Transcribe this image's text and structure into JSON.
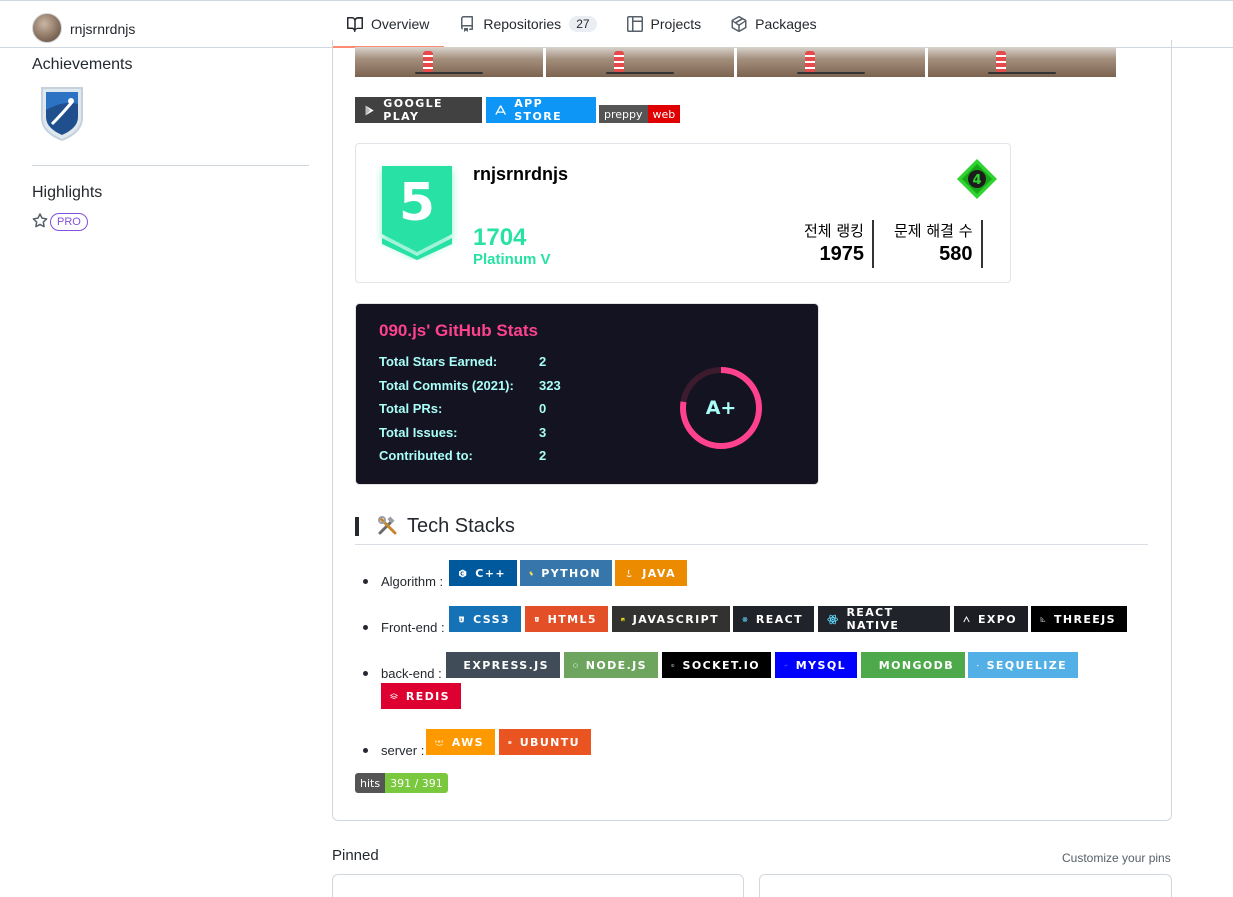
{
  "header": {
    "username": "rnjsrnrdnjs",
    "tabs": [
      {
        "label": "Overview",
        "icon": "book-icon",
        "active": true
      },
      {
        "label": "Repositories",
        "icon": "repo-icon",
        "count": "27"
      },
      {
        "label": "Projects",
        "icon": "project-icon"
      },
      {
        "label": "Packages",
        "icon": "package-icon"
      }
    ]
  },
  "sidebar": {
    "achievements_title": "Achievements",
    "highlights_title": "Highlights",
    "pro_label": "PRO"
  },
  "readme": {
    "store_badges": [
      {
        "label": "GOOGLE PLAY",
        "color": "#414141",
        "icon": "google-play-icon"
      },
      {
        "label": "APP STORE",
        "color": "#0d96f6",
        "icon": "app-store-icon"
      }
    ],
    "preppy_badge": {
      "left": "preppy",
      "right": "web",
      "right_color": "#e10000"
    },
    "solved": {
      "username": "rnjsrnrdnjs",
      "tier_number": "5",
      "rating": "1704",
      "tier_name": "Platinum V",
      "class_number": "4",
      "rank_label": "전체 랭킹",
      "rank_value": "1975",
      "solved_label": "문제 해결 수",
      "solved_value": "580",
      "accent": "#27e2a4"
    },
    "github_stats": {
      "title": "090.js' GitHub Stats",
      "rows": [
        {
          "label": "Total Stars Earned:",
          "value": "2"
        },
        {
          "label": "Total Commits (2021):",
          "value": "323"
        },
        {
          "label": "Total PRs:",
          "value": "0"
        },
        {
          "label": "Total Issues:",
          "value": "3"
        },
        {
          "label": "Contributed to:",
          "value": "2"
        }
      ],
      "grade": "A+",
      "bg": "#141321",
      "title_color": "#fe428e",
      "text_color": "#a9fef7"
    },
    "tech_stacks": {
      "title": "Tech Stacks",
      "emoji": "hammer-and-wrench-icon",
      "groups": [
        {
          "label": "Algorithm :",
          "badges": [
            {
              "label": "C++",
              "color": "#00599c",
              "icon": "cpp-icon"
            },
            {
              "label": "PYTHON",
              "color": "#3776ab",
              "icon": "python-icon"
            },
            {
              "label": "JAVA",
              "color": "#ed8b00",
              "icon": "java-icon"
            }
          ]
        },
        {
          "label": "Front-end :",
          "badges": [
            {
              "label": "CSS3",
              "color": "#1572b6",
              "icon": "css3-icon"
            },
            {
              "label": "HTML5",
              "color": "#e34f26",
              "icon": "html5-icon"
            },
            {
              "label": "JAVASCRIPT",
              "color": "#323330",
              "icon": "javascript-icon"
            },
            {
              "label": "REACT",
              "color": "#20232a",
              "icon": "react-icon"
            },
            {
              "label": "REACT NATIVE",
              "color": "#20232a",
              "icon": "react-native-icon"
            },
            {
              "label": "EXPO",
              "color": "#1c1e24",
              "icon": "expo-icon"
            },
            {
              "label": "THREEJS",
              "color": "#000000",
              "icon": "threejs-icon"
            }
          ]
        },
        {
          "label": "back-end :",
          "badges": [
            {
              "label": "EXPRESS.JS",
              "color": "#404d59",
              "icon": "express-icon"
            },
            {
              "label": "NODE.JS",
              "color": "#6da55f",
              "icon": "nodejs-icon"
            },
            {
              "label": "SOCKET.IO",
              "color": "#000000",
              "icon": "socketio-icon"
            },
            {
              "label": "MYSQL",
              "color": "#0000ff",
              "icon": "mysql-icon"
            },
            {
              "label": "MONGODB",
              "color": "#4ea94b",
              "icon": "mongodb-icon"
            },
            {
              "label": "SEQUELIZE",
              "color": "#52b0e7",
              "icon": "sequelize-icon"
            },
            {
              "label": "REDIS",
              "color": "#dd0031",
              "icon": "redis-icon"
            }
          ]
        },
        {
          "label": "server :",
          "badges": [
            {
              "label": "AWS",
              "color": "#ff9900",
              "icon": "aws-icon"
            },
            {
              "label": "UBUNTU",
              "color": "#e95420",
              "icon": "ubuntu-icon"
            }
          ]
        }
      ]
    },
    "hits": {
      "left": "hits",
      "right": "391 / 391"
    }
  },
  "pinned": {
    "title": "Pinned",
    "customize": "Customize your pins"
  }
}
